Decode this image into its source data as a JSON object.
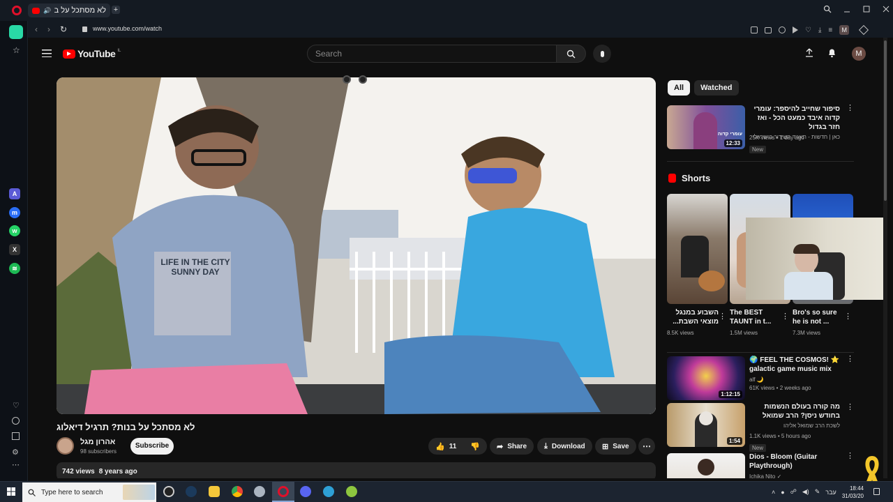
{
  "browser": {
    "tab_title": "לא מסתכל על בנות? ה",
    "url": "www.youtube.com/watch",
    "profile_initial": "M"
  },
  "header": {
    "logo_text": "YouTube",
    "country_code": "IL",
    "search_placeholder": "Search",
    "avatar_initial": "M"
  },
  "video": {
    "title": "לא מסתכל על בנות? תרגיל דיאלוג",
    "channel_name": "אהרון מגל",
    "subscribers": "98 subscribers",
    "subscribe_label": "Subscribe",
    "likes": "11",
    "share_label": "Share",
    "download_label": "Download",
    "save_label": "Save",
    "views": "742 views",
    "age": "8 years ago",
    "shirt_text_1": "LIFE IN THE CITY",
    "shirt_text_2": "SUNNY DAY"
  },
  "filters": [
    {
      "label": "All",
      "active": true
    },
    {
      "label": "Watched",
      "active": false
    }
  ],
  "recommended_top": {
    "title": "סיפור שחייב להיספר: עומרי קדוה איבד כמעט הכל - ואז חזר בגדול",
    "channel": "כאן | חדשות - תאגיד השידור הישראלי",
    "meta": "25K views • 1 day ago",
    "badge": "New",
    "duration": "12:33",
    "thumb_caption": "עומרי קדוה"
  },
  "shorts": {
    "heading": "Shorts",
    "items": [
      {
        "title": "השבוע במנגל מוצאי השבת...",
        "views": "8.5K views"
      },
      {
        "title": "The BEST TAUNT in t...",
        "views": "1.5M views"
      },
      {
        "title": "Bro's so sure he is not ...",
        "views": "7.3M views"
      }
    ]
  },
  "recommended_list": [
    {
      "title": "🌍 FEEL THE COSMOS! ⭐ galactic game music mix",
      "channel": "alf 🌙",
      "meta": "61K views • 2 weeks ago",
      "badge": "",
      "duration": "1:12:15"
    },
    {
      "title": "מה קורה בעולם הנשמות בחודש ניסן? הרב שמואל אליהו | הלכה יומית | ב'...",
      "channel": "לשכת הרב שמואל אליהו",
      "meta": "1.1K views • 5 hours ago",
      "badge": "New",
      "duration": "1:54"
    },
    {
      "title": "Dios - Bloom (Guitar Playthrough)",
      "channel": "Ichika Nito ✓",
      "meta": "",
      "badge": "",
      "duration": ""
    }
  ],
  "taskbar": {
    "search_placeholder": "Type here to search",
    "language": "עבר",
    "time": "18:44",
    "date": "31/03/20"
  }
}
